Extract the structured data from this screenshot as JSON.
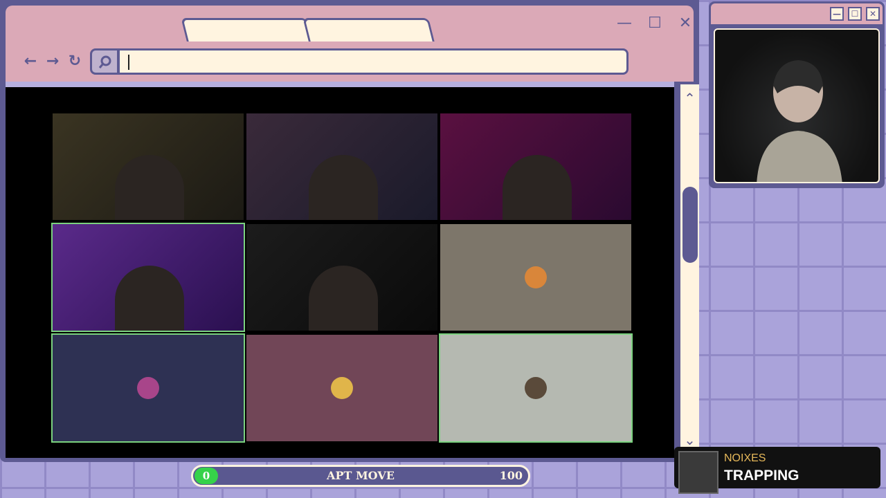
{
  "browser": {
    "tabs": [
      "",
      ""
    ],
    "url_value": "",
    "controls": {
      "back": "←",
      "forward": "→",
      "reload": "↻",
      "minimize": "—",
      "maximize": "☐",
      "close": "✕"
    }
  },
  "scrollbar": {
    "up": "⌃",
    "down": "⌄"
  },
  "video_call": {
    "tiles": [
      {
        "kind": "camera",
        "speaking": false
      },
      {
        "kind": "camera",
        "speaking": false
      },
      {
        "kind": "camera",
        "speaking": false
      },
      {
        "kind": "camera",
        "speaking": true
      },
      {
        "kind": "camera",
        "speaking": false
      },
      {
        "kind": "avatar",
        "speaking": false,
        "background": "#7d766a"
      },
      {
        "kind": "avatar",
        "speaking": true,
        "background": "#2e3153"
      },
      {
        "kind": "avatar",
        "speaking": false,
        "background": "#714657"
      },
      {
        "kind": "avatar",
        "speaking": true,
        "background": "#b5b9b1"
      }
    ]
  },
  "camera_window": {
    "buttons": {
      "minimize": "—",
      "maximize": "☐",
      "close": "✕"
    }
  },
  "progress": {
    "current": "0",
    "label": "APT MOVE",
    "max": "100",
    "fraction": 0
  },
  "now_playing": {
    "artist": "NOIXES",
    "title": "TRAPPING"
  },
  "colors": {
    "accent": "#5d5a92",
    "frame": "#dba9b7",
    "cream": "#fff4e0",
    "progress": "#36d24a"
  }
}
